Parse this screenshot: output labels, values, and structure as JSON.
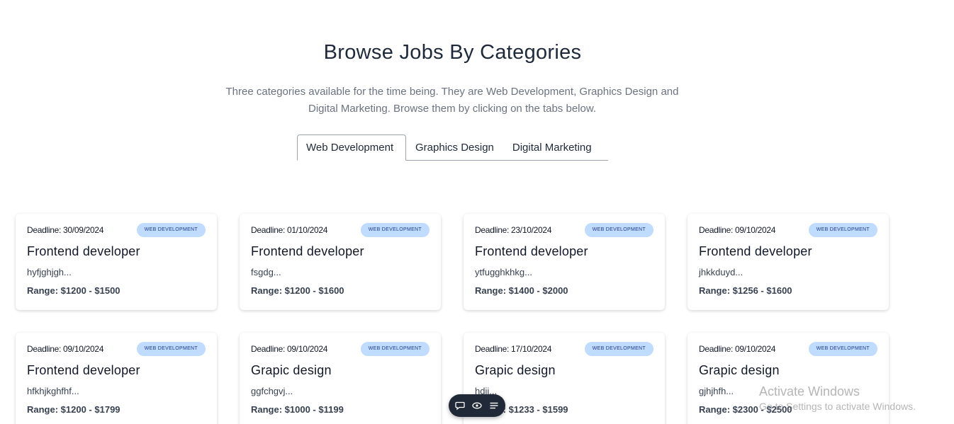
{
  "heading": "Browse Jobs By Categories",
  "subtitle": "Three categories available for the time being. They are Web Development, Graphics Design and Digital Marketing. Browse them by clicking on the tabs below.",
  "tabs": [
    {
      "label": "Web Development",
      "active": true
    },
    {
      "label": "Graphics Design",
      "active": false
    },
    {
      "label": "Digital Marketing",
      "active": false
    }
  ],
  "jobs": [
    {
      "deadline": "Deadline: 30/09/2024",
      "badge": "Web Development",
      "title": "Frontend developer",
      "desc": "hyfjghjgh...",
      "range": "Range: $1200 - $1500"
    },
    {
      "deadline": "Deadline: 01/10/2024",
      "badge": "Web Development",
      "title": "Frontend developer",
      "desc": "fsgdg...",
      "range": "Range: $1200 - $1600"
    },
    {
      "deadline": "Deadline: 23/10/2024",
      "badge": "Web Development",
      "title": "Frontend developer",
      "desc": "ytfugghkhkg...",
      "range": "Range: $1400 - $2000"
    },
    {
      "deadline": "Deadline: 09/10/2024",
      "badge": "Web Development",
      "title": "Frontend developer",
      "desc": "jhkkduyd...",
      "range": "Range: $1256 - $1600"
    },
    {
      "deadline": "Deadline: 09/10/2024",
      "badge": "Web Development",
      "title": "Frontend developer",
      "desc": "hfkhjkghfhf...",
      "range": "Range: $1200 - $1799"
    },
    {
      "deadline": "Deadline: 09/10/2024",
      "badge": "Web Development",
      "title": "Grapic design",
      "desc": "ggfchgvj...",
      "range": "Range: $1000 - $1199"
    },
    {
      "deadline": "Deadline: 17/10/2024",
      "badge": "Web Development",
      "title": "Grapic design",
      "desc": "hdij...",
      "range": "Range: $1233 - $1599"
    },
    {
      "deadline": "Deadline: 09/10/2024",
      "badge": "Web Development",
      "title": "Grapic design",
      "desc": "gjhjhfh...",
      "range": "Range: $2300 - $2500"
    }
  ],
  "floating_toolbar": {
    "icons": [
      "comment-icon",
      "eye-icon",
      "list-icon"
    ]
  },
  "watermark": {
    "title": "Activate Windows",
    "subtitle": "Go to Settings to activate Windows."
  },
  "colors": {
    "badge_bg": "#bfdbfe",
    "badge_text": "#1e3a8a",
    "toolbar_bg": "#1f2937"
  }
}
